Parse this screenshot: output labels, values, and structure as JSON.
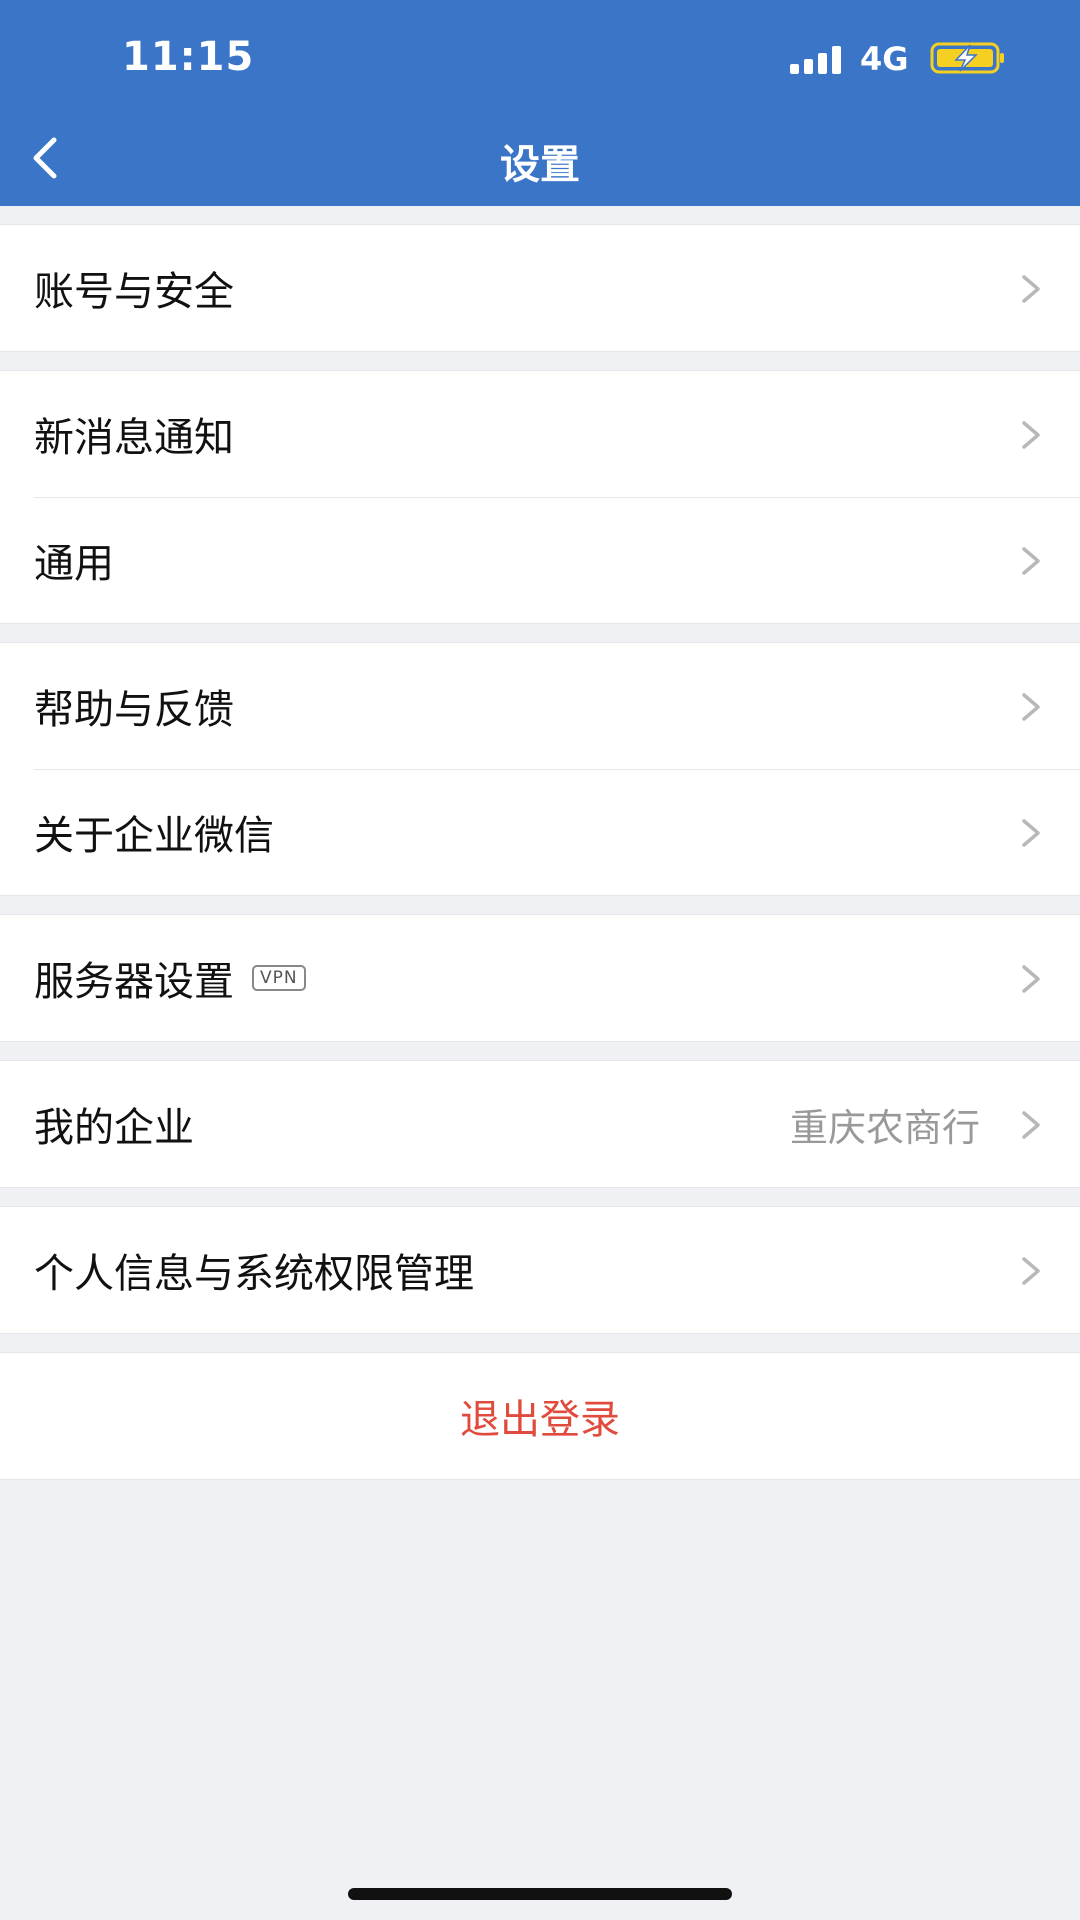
{
  "status_bar": {
    "time": "11:15",
    "network": "4G",
    "icons": [
      "signal-icon",
      "battery-charging-icon"
    ]
  },
  "nav": {
    "title": "设置",
    "back_icon": "chevron-left-icon"
  },
  "groups": [
    {
      "items": [
        {
          "label": "账号与安全"
        }
      ]
    },
    {
      "items": [
        {
          "label": "新消息通知"
        },
        {
          "label": "通用"
        }
      ]
    },
    {
      "items": [
        {
          "label": "帮助与反馈"
        },
        {
          "label": "关于企业微信"
        }
      ]
    },
    {
      "items": [
        {
          "label": "服务器设置",
          "badge": "VPN"
        }
      ]
    },
    {
      "items": [
        {
          "label": "我的企业",
          "value": "重庆农商行"
        }
      ]
    },
    {
      "items": [
        {
          "label": "个人信息与系统权限管理"
        }
      ]
    }
  ],
  "logout_label": "退出登录",
  "colors": {
    "header_bg": "#3b75c7",
    "logout_text": "#e14b3d",
    "page_bg": "#f0f1f4",
    "battery_fill": "#f5d020"
  }
}
